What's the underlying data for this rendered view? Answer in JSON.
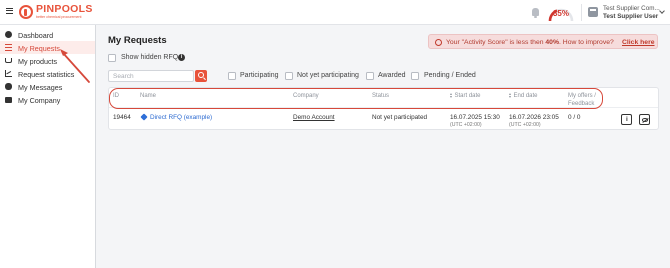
{
  "app": {
    "logo_name": "PINPOOLS",
    "logo_tagline": "better chemical procurement"
  },
  "header": {
    "activity_score": "35%",
    "supplier_company": "Test Supplier Com...",
    "supplier_user": "Test Supplier User"
  },
  "sidebar": {
    "items": [
      {
        "label": "Dashboard",
        "icon": "dashboard-icon"
      },
      {
        "label": "My Requests",
        "icon": "list-icon",
        "active": true
      },
      {
        "label": "My products",
        "icon": "cart-icon"
      },
      {
        "label": "Request statistics",
        "icon": "chart-icon"
      },
      {
        "label": "My Messages",
        "icon": "messages-icon"
      },
      {
        "label": "My Company",
        "icon": "company-icon"
      }
    ]
  },
  "main": {
    "title": "My Requests",
    "show_hidden_label": "Show hidden RFQ",
    "alert": {
      "prefix": "Your \"Activity Score\" is less then ",
      "score": "40%",
      "suffix": ". How to improve?",
      "link": "Click here"
    },
    "search": {
      "placeholder": "Search",
      "value": ""
    },
    "filters": [
      "Participating",
      "Not yet participating",
      "Awarded",
      "Pending / Ended"
    ],
    "table": {
      "headers": {
        "id": "ID",
        "name": "Name",
        "company": "Company",
        "status": "Status",
        "start_date": "Start date",
        "end_date": "End date",
        "offers_line1": "My offers /",
        "offers_line2": "Feedback"
      },
      "rows": [
        {
          "id": "19464",
          "name": "Direct RFQ (example)",
          "company": "Demo Account",
          "status": "Not yet participated",
          "start_date": "16.07.2025 15:30",
          "start_tz": "(UTC +02:00)",
          "end_date": "16.07.2026 23:05",
          "end_tz": "(UTC +02:00)",
          "offers": "0 / 0"
        }
      ]
    }
  },
  "colors": {
    "accent": "#e8533b",
    "active_nav_bg": "#fdecea",
    "annotation": "#d6493b",
    "link": "#2d6bd1",
    "alert_bg": "#f6dcdc"
  }
}
